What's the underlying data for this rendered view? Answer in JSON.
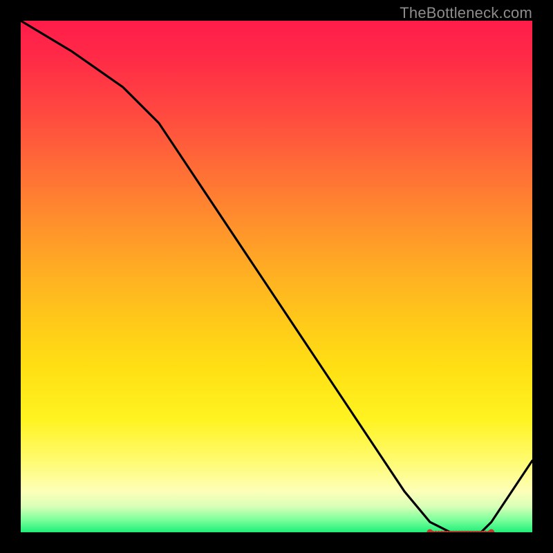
{
  "watermark": "TheBottleneck.com",
  "chart_data": {
    "type": "line",
    "title": "",
    "xlabel": "",
    "ylabel": "",
    "xlim": [
      0,
      100
    ],
    "ylim": [
      0,
      100
    ],
    "grid": false,
    "series": [
      {
        "name": "curve",
        "x": [
          0,
          10,
          20,
          27,
          35,
          45,
          55,
          65,
          75,
          80,
          84,
          86,
          88,
          90,
          92,
          100
        ],
        "y": [
          100,
          94,
          87,
          80,
          68,
          53,
          38,
          23,
          8,
          2,
          0,
          0,
          0,
          0,
          2,
          14
        ]
      }
    ],
    "flat_region": {
      "x_start": 80,
      "x_end": 92,
      "y": 0,
      "marker_color": "#c0392b",
      "marker_count": 22
    },
    "colors": {
      "line": "#000000",
      "background_top": "#ff1c4b",
      "background_bottom": "#1eef7a",
      "frame": "#000000"
    }
  }
}
